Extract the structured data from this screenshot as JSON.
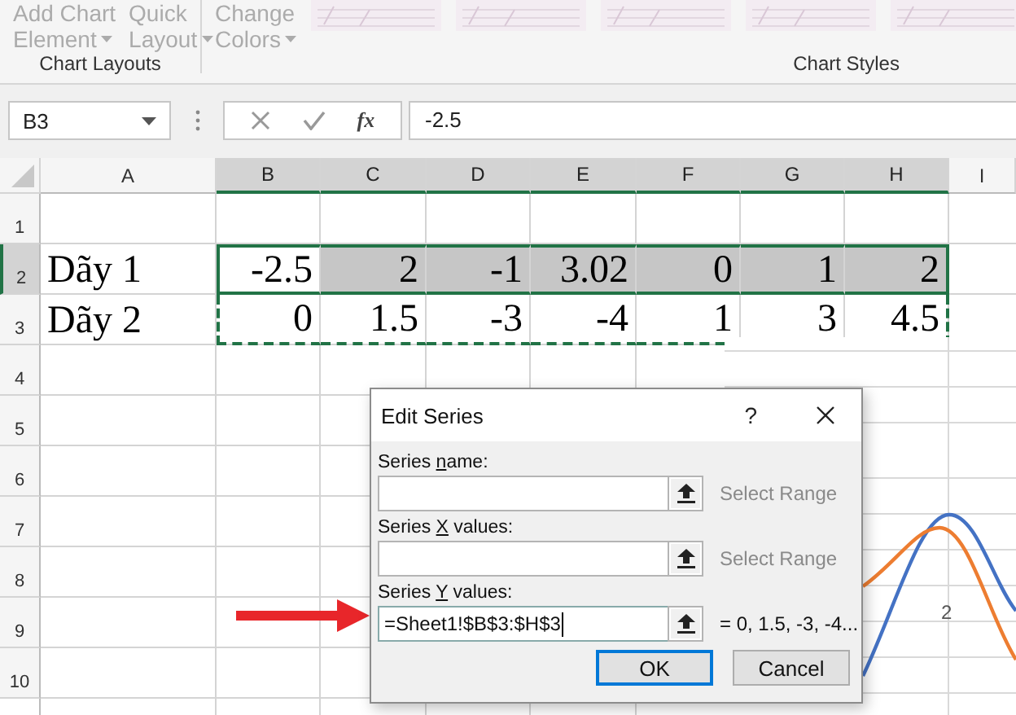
{
  "ribbon": {
    "groups": [
      {
        "label": "Chart Layouts",
        "buttons": [
          {
            "lines": [
              "Add Chart",
              "Element"
            ],
            "dropdown": true,
            "disabled": true
          },
          {
            "lines": [
              "Quick",
              "Layout"
            ],
            "dropdown": true,
            "disabled": true
          }
        ]
      },
      {
        "label": "Chart Styles",
        "buttons": [
          {
            "lines": [
              "Change",
              "Colors"
            ],
            "dropdown": true,
            "disabled": true
          }
        ]
      }
    ]
  },
  "formula_bar": {
    "name_box": "B3",
    "function_label": "fx",
    "value": "-2.5"
  },
  "sheet": {
    "columns": [
      {
        "label": "A",
        "selected": false
      },
      {
        "label": "B",
        "selected": true
      },
      {
        "label": "C",
        "selected": true
      },
      {
        "label": "D",
        "selected": true
      },
      {
        "label": "E",
        "selected": true
      },
      {
        "label": "F",
        "selected": true
      },
      {
        "label": "G",
        "selected": true
      },
      {
        "label": "H",
        "selected": true
      },
      {
        "label": "I",
        "selected": false
      }
    ],
    "rows": [
      {
        "header": "1",
        "selected": false
      },
      {
        "header": "2",
        "selected": true,
        "cells": [
          {
            "text": "Dãy 1",
            "kind": "label",
            "selected": false
          },
          {
            "text": "-2.5",
            "kind": "number",
            "selected": false
          },
          {
            "text": "2",
            "kind": "number",
            "selected": true
          },
          {
            "text": "-1",
            "kind": "number",
            "selected": true
          },
          {
            "text": "3.02",
            "kind": "number",
            "selected": true
          },
          {
            "text": "0",
            "kind": "number",
            "selected": true
          },
          {
            "text": "1",
            "kind": "number",
            "selected": true
          },
          {
            "text": "2",
            "kind": "number",
            "selected": true
          }
        ]
      },
      {
        "header": "3",
        "selected": false,
        "marquee": true,
        "cells": [
          {
            "text": "Dãy 2",
            "kind": "label",
            "selected": false
          },
          {
            "text": "0",
            "kind": "number",
            "selected": false
          },
          {
            "text": "1.5",
            "kind": "number",
            "selected": false
          },
          {
            "text": "-3",
            "kind": "number",
            "selected": false
          },
          {
            "text": "-4",
            "kind": "number",
            "selected": false
          },
          {
            "text": "1",
            "kind": "number",
            "selected": false
          },
          {
            "text": "3",
            "kind": "number",
            "selected": false
          },
          {
            "text": "4.5",
            "kind": "number",
            "selected": false
          }
        ]
      },
      {
        "header": "4",
        "selected": false
      },
      {
        "header": "5",
        "selected": false
      },
      {
        "header": "6",
        "selected": false
      },
      {
        "header": "7",
        "selected": false
      },
      {
        "header": "8",
        "selected": false
      },
      {
        "header": "9",
        "selected": false
      },
      {
        "header": "10",
        "selected": false
      }
    ]
  },
  "chart": {
    "axis_label": "2",
    "series": [
      {
        "color": "#4472c4"
      },
      {
        "color": "#ed7d31"
      }
    ]
  },
  "dialog": {
    "title": "Edit Series",
    "help": "?",
    "fields": [
      {
        "label": "Series ",
        "key": "n",
        "rest": "ame:",
        "focused": false,
        "preview": {
          "text": "Select Range",
          "dimmed": true
        }
      },
      {
        "label": "Series ",
        "key": "X",
        "rest": " values:",
        "focused": false,
        "preview": {
          "text": "Select Range",
          "dimmed": true
        }
      },
      {
        "label": "Series ",
        "key": "Y",
        "rest": " values:",
        "value": "=Sheet1!$B$3:$H$3",
        "focused": true,
        "preview": {
          "text": "= 0, 1.5, -3, -4...",
          "dimmed": false
        }
      }
    ],
    "buttons": [
      {
        "label": "OK",
        "default": true
      },
      {
        "label": "Cancel",
        "default": false
      }
    ]
  }
}
